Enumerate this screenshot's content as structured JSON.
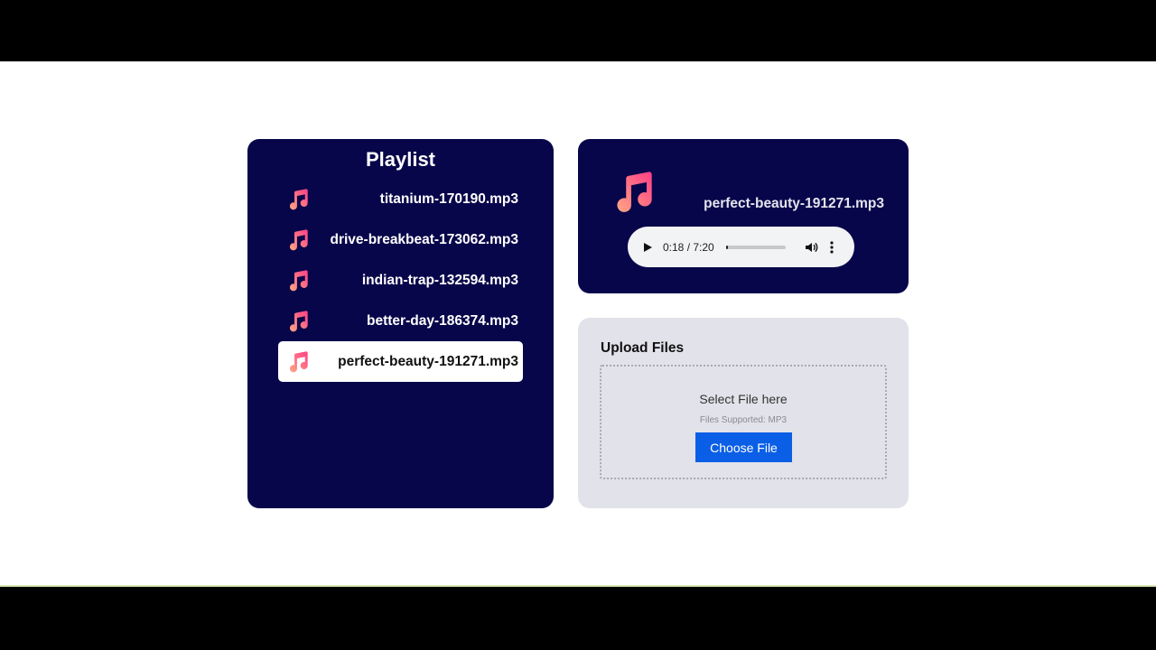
{
  "playlist": {
    "title": "Playlist",
    "tracks": [
      {
        "label": "titanium-170190.mp3",
        "active": false
      },
      {
        "label": "drive-breakbeat-173062.mp3",
        "active": false
      },
      {
        "label": "indian-trap-132594.mp3",
        "active": false
      },
      {
        "label": "better-day-186374.mp3",
        "active": false
      },
      {
        "label": "perfect-beauty-191271.mp3",
        "active": true
      }
    ],
    "icon": "music-note-icon"
  },
  "player": {
    "now_playing": "perfect-beauty-191271.mp3",
    "time": "0:18 / 7:20",
    "progress_fraction": 0.04
  },
  "upload": {
    "title": "Upload Files",
    "drop_text": "Select File here",
    "supported": "Files Supported: MP3",
    "button_label": "Choose File"
  },
  "colors": {
    "panel_dark": "#08064a",
    "panel_light": "#e2e2ea",
    "accent_button": "#0b5fe6",
    "note_gradient_start": "#ff4f8b",
    "note_gradient_end": "#ffa07a"
  }
}
